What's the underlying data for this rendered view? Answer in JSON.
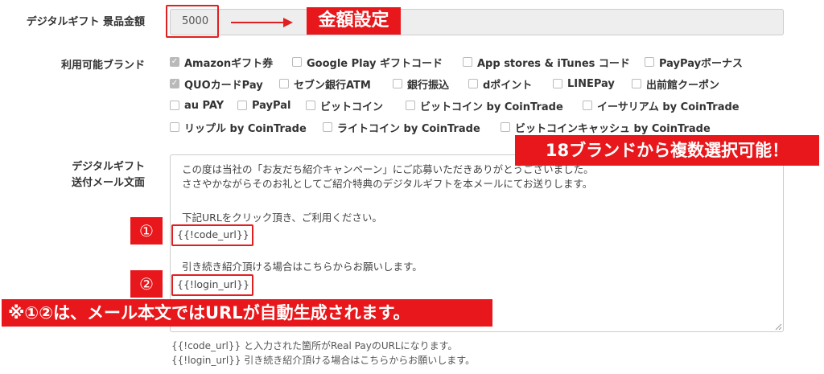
{
  "amount": {
    "label": "デジタルギフト 景品金額",
    "value": "5000",
    "callout": "金額設定"
  },
  "brands": {
    "label": "利用可能ブランド",
    "items": [
      {
        "name": "Amazonギフト券",
        "checked": true
      },
      {
        "name": "Google Play ギフトコード",
        "checked": false
      },
      {
        "name": "App stores & iTunes コード",
        "checked": false
      },
      {
        "name": "PayPayボーナス",
        "checked": false
      },
      {
        "name": "QUOカードPay",
        "checked": true
      },
      {
        "name": "セブン銀行ATM",
        "checked": false
      },
      {
        "name": "銀行振込",
        "checked": false
      },
      {
        "name": "dポイント",
        "checked": false
      },
      {
        "name": "LINEPay",
        "checked": false
      },
      {
        "name": "出前館クーポン",
        "checked": false
      },
      {
        "name": "au PAY",
        "checked": false
      },
      {
        "name": "PayPal",
        "checked": false
      },
      {
        "name": "ビットコイン",
        "checked": false
      },
      {
        "name": "ビットコイン by CoinTrade",
        "checked": false
      },
      {
        "name": "イーサリアム by CoinTrade",
        "checked": false
      },
      {
        "name": "リップル by CoinTrade",
        "checked": false
      },
      {
        "name": "ライトコイン by CoinTrade",
        "checked": false
      },
      {
        "name": "ビットコインキャッシュ by CoinTrade",
        "checked": false
      }
    ],
    "callout": "18ブランドから複数選択可能！"
  },
  "mail": {
    "label_line1": "デジタルギフト",
    "label_line2": "送付メール文面",
    "lines": [
      "この度は当社の「お友だち紹介キャンペーン」にご応募いただきありがとうございました。",
      "ささやかながらそのお礼としてご紹介特典のデジタルギフトを本メールにてお送りします。",
      "下記URLをクリック頂き、ご利用ください。",
      "{{!code_url}}",
      "引き続き紹介頂ける場合はこちらからお願いします。",
      "{{!login_url}}"
    ],
    "marker1": "①",
    "marker2": "②",
    "callout": "※①②は、メール本文ではURLが自動生成されます。"
  },
  "hints": [
    "{{!code_url}} と入力された箇所がReal PayのURLになります。",
    "{{!login_url}} 引き続き紹介頂ける場合はこちらからお願いします。"
  ],
  "colors": {
    "accent_red": "#e8171b",
    "checkbox_checked": "#b9b9b9",
    "input_bg": "#eeeeee"
  }
}
